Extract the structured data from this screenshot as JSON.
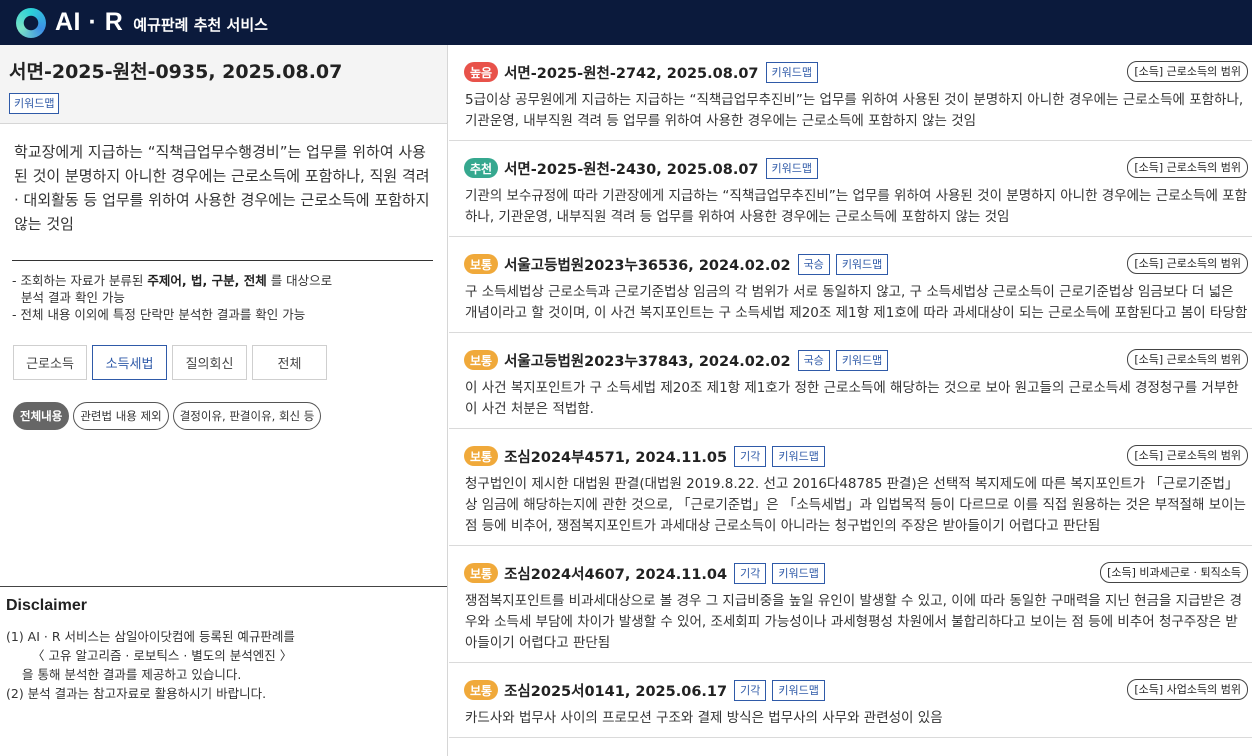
{
  "header": {
    "logo_text": "AI · R",
    "service_name": "예규판례 추천 서비스"
  },
  "left": {
    "title": "서면-2025-원천-0935, 2025.08.07",
    "keyword_chip": "키워드맵",
    "summary": "학교장에게 지급하는 “직책급업무수행경비”는 업무를 위하여 사용된 것이 분명하지 아니한 경우에는 근로소득에 포함하나, 직원 격려 · 대외활동 등 업무를 위하여 사용한 경우에는 근로소득에 포함하지 않는 것임",
    "notes": {
      "line1_pre": "- 조회하는 자료가 분류된 ",
      "line1_bold": "주제어, 법, 구분, 전체",
      "line1_post": " 를 대상으로",
      "line2": "분석 결과 확인 가능",
      "line3": "- 전체 내용 이외에 특정 단락만 분석한 결과를 확인 가능"
    },
    "tabs": [
      {
        "label": "근로소득",
        "active": false
      },
      {
        "label": "소득세법",
        "active": true
      },
      {
        "label": "질의회신",
        "active": false
      },
      {
        "label": "전체",
        "active": false
      }
    ],
    "pills": [
      {
        "label": "전체내용",
        "active": true
      },
      {
        "label": "관련법 내용 제외",
        "active": false
      },
      {
        "label": "결정이유, 판결이유, 회신 등",
        "active": false
      }
    ]
  },
  "disclaimer": {
    "title": "Disclaimer",
    "lines": [
      "(1) AI · R 서비스는 삼일아이닷컴에 등록된 예규판례를",
      "〈 고유 알고리즘 · 로보틱스 · 별도의 분석엔진 〉",
      "을 통해 분석한 결과를 제공하고 있습니다.",
      "(2) 분석 결과는 참고자료로 활용하시기 바랍니다."
    ]
  },
  "colors": {
    "badge_high": "#e8524a",
    "badge_recommend": "#36a88f",
    "badge_normal": "#f0a93a",
    "accent": "#2f5aa8",
    "header_bg": "#0b1a3c"
  },
  "results": [
    {
      "badge": "높음",
      "badge_color": "#e8524a",
      "title": "서면-2025-원천-2742, 2025.08.07",
      "tags": [
        "키워드맵"
      ],
      "category": "[소득] 근로소득의 범위",
      "body": "5급이상 공무원에게 지급하는 지급하는 “직책급업무추진비”는 업무를 위하여 사용된 것이 분명하지 아니한 경우에는 근로소득에 포함하나, 기관운영, 내부직원 격려 등 업무를 위하여 사용한 경우에는 근로소득에 포함하지 않는 것임"
    },
    {
      "badge": "추천",
      "badge_color": "#36a88f",
      "title": "서면-2025-원천-2430, 2025.08.07",
      "tags": [
        "키워드맵"
      ],
      "category": "[소득] 근로소득의 범위",
      "body": "기관의 보수규정에 따라 기관장에게 지급하는 “직책급업무추진비”는 업무를 위하여 사용된 것이 분명하지 아니한 경우에는 근로소득에 포함하나, 기관운영, 내부직원 격려 등 업무를 위하여 사용한 경우에는 근로소득에 포함하지 않는 것임"
    },
    {
      "badge": "보통",
      "badge_color": "#f0a93a",
      "title": "서울고등법원2023누36536, 2024.02.02",
      "tags": [
        "국승",
        "키워드맵"
      ],
      "category": "[소득] 근로소득의 범위",
      "body": "구 소득세법상 근로소득과 근로기준법상 임금의 각 범위가 서로 동일하지 않고, 구 소득세법상 근로소득이 근로기준법상 임금보다 더 넓은 개념이라고 할 것이며, 이 사건 복지포인트는 구 소득세법 제20조 제1항 제1호에 따라 과세대상이 되는 근로소득에 포함된다고 봄이 타당함"
    },
    {
      "badge": "보통",
      "badge_color": "#f0a93a",
      "title": "서울고등법원2023누37843, 2024.02.02",
      "tags": [
        "국승",
        "키워드맵"
      ],
      "category": "[소득] 근로소득의 범위",
      "body": "이 사건 복지포인트가 구 소득세법 제20조 제1항 제1호가 정한 근로소득에 해당하는 것으로 보아 원고들의 근로소득세 경정청구를 거부한 이 사건 처분은 적법함."
    },
    {
      "badge": "보통",
      "badge_color": "#f0a93a",
      "title": "조심2024부4571, 2024.11.05",
      "tags": [
        "기각",
        "키워드맵"
      ],
      "category": "[소득] 근로소득의 범위",
      "body": "청구법인이 제시한 대법원 판결(대법원 2019.8.22. 선고 2016다48785 판결)은 선택적 복지제도에 따른 복지포인트가 「근로기준법」상 임금에 해당하는지에 관한 것으로, 「근로기준법」은 「소득세법」과 입법목적 등이 다르므로 이를 직접 원용하는 것은 부적절해 보이는 점 등에 비추어, 쟁점복지포인트가 과세대상 근로소득이 아니라는 청구법인의 주장은 받아들이기 어렵다고 판단됨"
    },
    {
      "badge": "보통",
      "badge_color": "#f0a93a",
      "title": "조심2024서4607, 2024.11.04",
      "tags": [
        "기각",
        "키워드맵"
      ],
      "category": "[소득] 비과세근로 · 퇴직소득",
      "body": "쟁점복지포인트를 비과세대상으로 볼 경우 그 지급비중을 높일 유인이 발생할 수 있고, 이에 따라 동일한 구매력을 지닌 현금을 지급받은 경우와 소득세 부담에 차이가 발생할 수 있어, 조세회피 가능성이나 과세형평성 차원에서 불합리하다고 보이는 점 등에 비추어 청구주장은 받아들이기 어렵다고 판단됨"
    },
    {
      "badge": "보통",
      "badge_color": "#f0a93a",
      "title": "조심2025서0141, 2025.06.17",
      "tags": [
        "기각",
        "키워드맵"
      ],
      "category": "[소득] 사업소득의 범위",
      "body": "카드사와 법무사 사이의 프로모션 구조와 결제 방식은 법무사의 사무와 관련성이 있음"
    }
  ]
}
